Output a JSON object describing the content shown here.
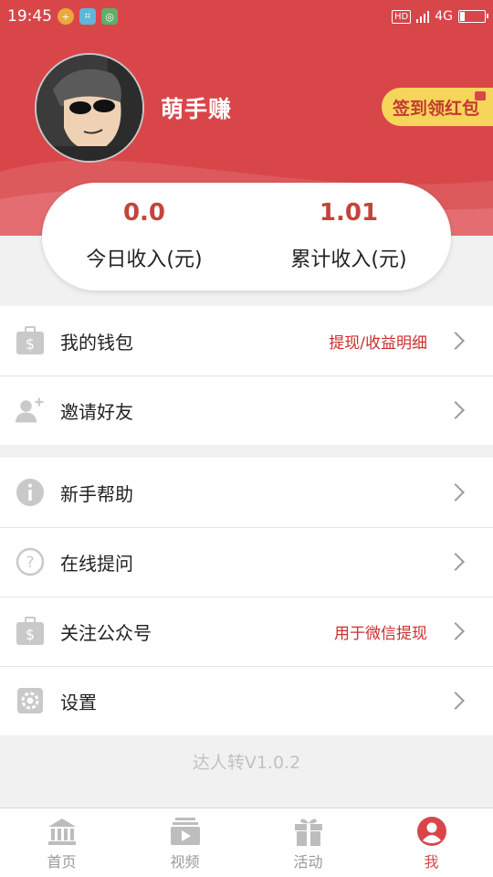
{
  "status_bar": {
    "time": "19:45",
    "network": "4G",
    "hd": "HD"
  },
  "profile": {
    "username": "萌手赚",
    "checkin_label": "签到领红包"
  },
  "income": [
    {
      "value": "0.0",
      "label": "今日收入(元)"
    },
    {
      "value": "1.01",
      "label": "累计收入(元)"
    }
  ],
  "menu_group1": [
    {
      "label": "我的钱包",
      "hint": "提现/收益明细",
      "icon": "wallet-icon"
    },
    {
      "label": "邀请好友",
      "hint": "",
      "icon": "add-user-icon"
    }
  ],
  "menu_group2": [
    {
      "label": "新手帮助",
      "hint": "",
      "icon": "info-icon"
    },
    {
      "label": "在线提问",
      "hint": "",
      "icon": "question-icon"
    },
    {
      "label": "关注公众号",
      "hint": "用于微信提现",
      "icon": "wallet-icon"
    },
    {
      "label": "设置",
      "hint": "",
      "icon": "gear-icon"
    }
  ],
  "version": "达人转V1.0.2",
  "tabs": [
    {
      "label": "首页",
      "icon": "home-icon",
      "active": false
    },
    {
      "label": "视频",
      "icon": "video-icon",
      "active": false
    },
    {
      "label": "活动",
      "icon": "gift-icon",
      "active": false
    },
    {
      "label": "我",
      "icon": "profile-icon",
      "active": true
    }
  ],
  "colors": {
    "brand_red": "#d8464a",
    "accent_yellow": "#f6d65a",
    "hint_red": "#cc2e2e"
  }
}
